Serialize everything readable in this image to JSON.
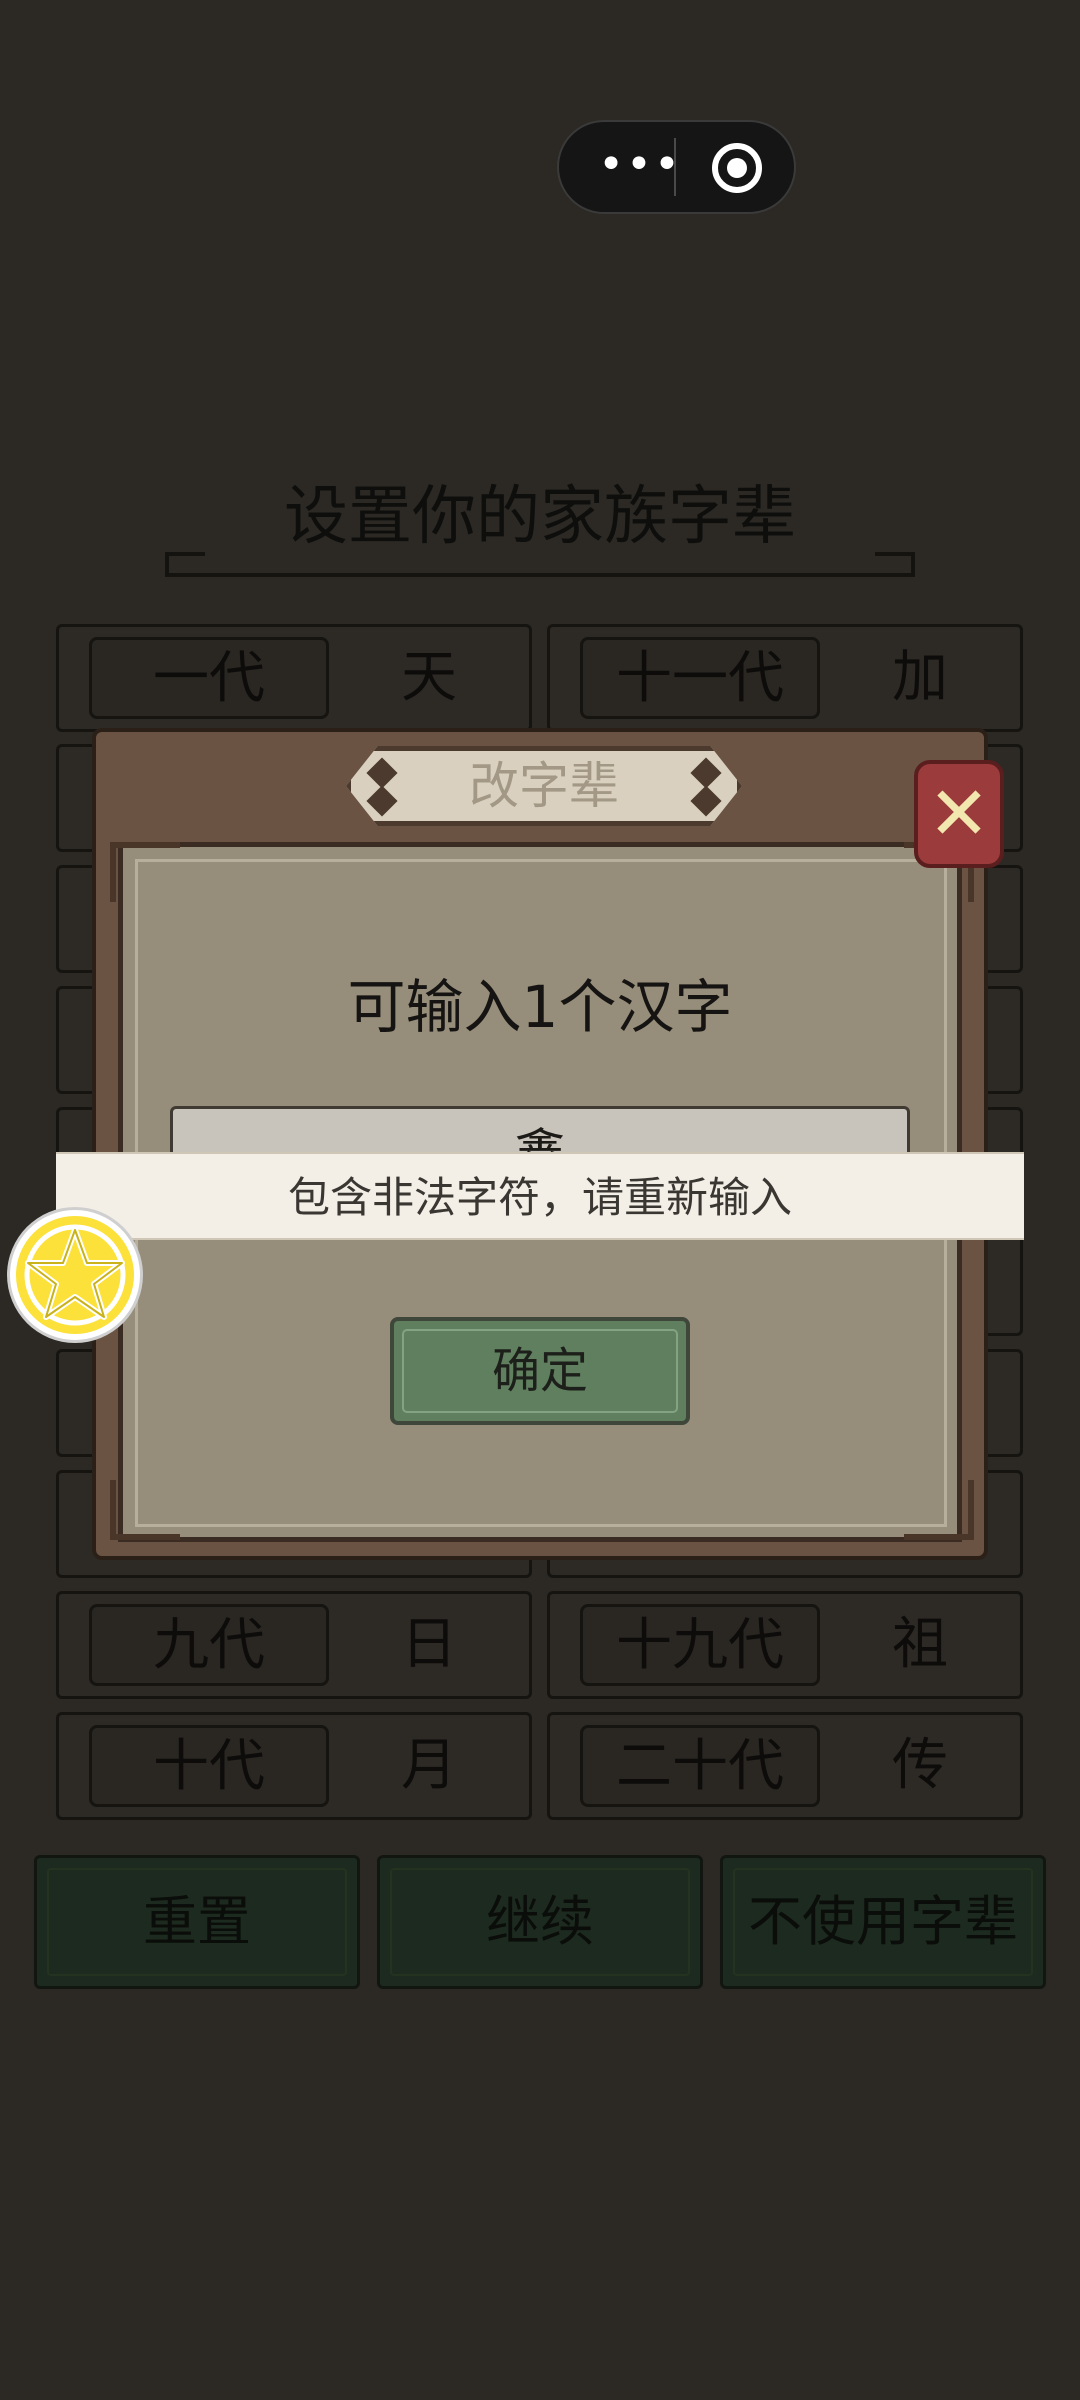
{
  "capsule": {
    "more_icon": "more-dots-icon",
    "close_icon": "target-circle-icon",
    "more_label": "•••"
  },
  "page": {
    "title": "设置你的家族字辈",
    "generations_left": [
      {
        "tag": "一代",
        "char": "天"
      },
      {
        "tag": "九代",
        "char": "日"
      },
      {
        "tag": "十代",
        "char": "月"
      }
    ],
    "generations_right": [
      {
        "tag": "十一代",
        "char": "加"
      },
      {
        "tag": "十九代",
        "char": "祖"
      },
      {
        "tag": "二十代",
        "char": "传"
      }
    ],
    "buttons": {
      "reset": "重置",
      "continue": "继续",
      "skip": "不使用字辈"
    }
  },
  "modal": {
    "title": "改字辈",
    "prompt": "可输入1个汉字",
    "input_value": "鑫",
    "confirm": "确定",
    "close_icon": "close-x-icon"
  },
  "toast": {
    "message": "包含非法字符，请重新输入"
  },
  "colors": {
    "overlay_bg": "#2c2924",
    "modal_frame": "#6a5343",
    "modal_inner": "#968d7a",
    "confirm_green": "#5f7f5e",
    "close_red": "#9b3b3b",
    "toast_bg": "#f3efe7",
    "badge_yellow": "#fbe13a"
  }
}
